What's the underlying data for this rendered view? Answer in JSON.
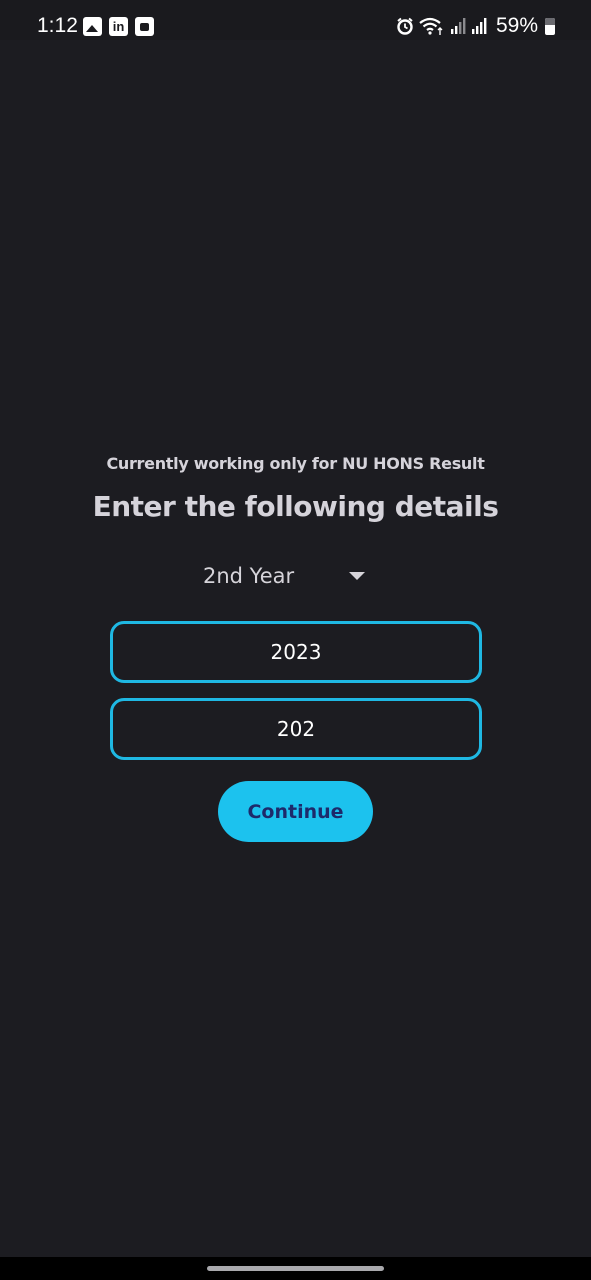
{
  "status_bar": {
    "time": "1:12",
    "battery_percent": "59%",
    "notification_icons": [
      "gallery-icon",
      "linkedin-icon",
      "bag-icon"
    ],
    "linkedin_glyph": "in",
    "system_icons": [
      "alarm-icon",
      "wifi-icon",
      "signal-icon",
      "signal-icon",
      "battery-icon"
    ]
  },
  "main": {
    "subtitle": "Currently working only for NU HONS Result",
    "heading": "Enter the following details",
    "year_select": {
      "value": "2nd Year"
    },
    "field_1": {
      "value": "2023"
    },
    "field_2": {
      "value": "202"
    },
    "continue_label": "Continue"
  },
  "colors": {
    "background": "#1c1c21",
    "accent": "#1fb8e3",
    "button": "#1cc2ee",
    "button_text": "#1d2a6b"
  }
}
